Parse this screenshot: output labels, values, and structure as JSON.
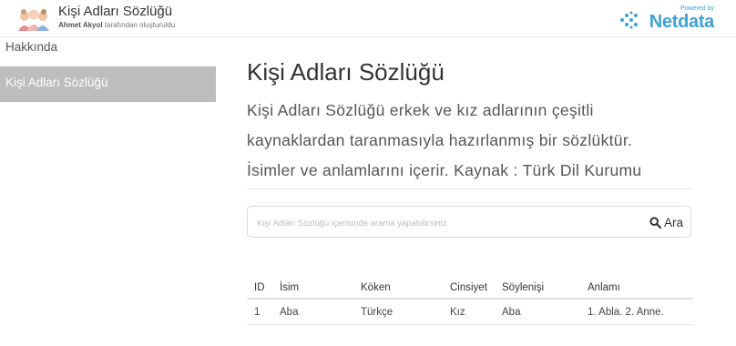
{
  "header": {
    "app_title": "Kişi Adları Sözlüğü",
    "author_name": "Ahmet Akyol",
    "author_suffix": " tarafından oluşturuldu",
    "powered_by": "Powered by",
    "brand": "Netdata"
  },
  "sidebar": {
    "items": [
      {
        "label": "Hakkında"
      },
      {
        "label": "Kişi Adları Sözlüğü"
      }
    ]
  },
  "main": {
    "title": "Kişi Adları Sözlüğü",
    "description_lines": [
      "Kişi Adları Sözlüğü erkek ve kız adlarının çeşitli",
      "kaynaklardan taranmasıyla hazırlanmış bir sözlüktür.",
      "İsimler ve anlamlarını içerir. Kaynak : Türk Dil Kurumu"
    ],
    "search": {
      "placeholder": "Kişi Adları Sözlüğü içerisinde arama yapabilirsiniz",
      "button_label": "Ara"
    },
    "table": {
      "headers": [
        "ID",
        "İsim",
        "Köken",
        "Cinsiyet",
        "Söylenişi",
        "Anlamı"
      ],
      "rows": [
        [
          "1",
          "Aba",
          "Türkçe",
          "Kız",
          "Aba",
          "1. Abla. 2. Anne."
        ]
      ]
    }
  },
  "colors": {
    "accent": "#3fa3d1",
    "sidebar_active_bg": "#bdbdbd"
  }
}
